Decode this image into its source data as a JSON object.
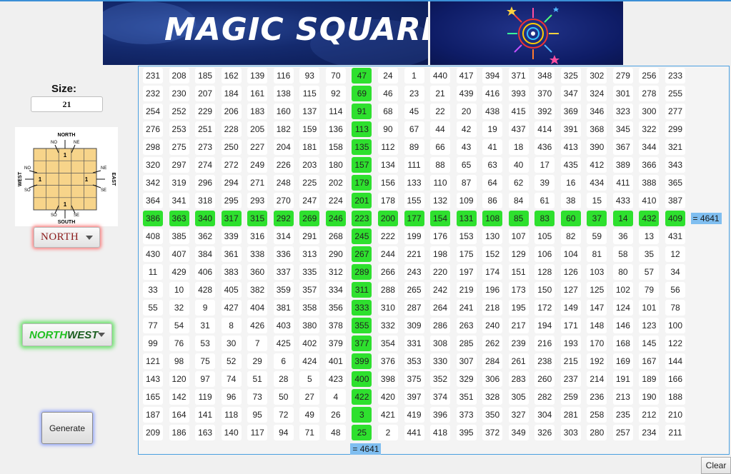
{
  "header": {
    "title": "MAGIC SQUARE"
  },
  "controls": {
    "size_label": "Size:",
    "size_value": "21",
    "compass": {
      "north": "NORTH",
      "south": "SOUTH",
      "east": "EAST",
      "west": "WEST",
      "nw": "NO",
      "ne": "NE",
      "sw": "SO",
      "se": "SE",
      "one": "1"
    },
    "start_direction": "NORTH",
    "move_direction": {
      "part1": "NORTH",
      "part2": "WEST"
    },
    "generate_label": "Generate"
  },
  "grid": {
    "size": 21,
    "highlight_row": 8,
    "highlight_col": 8,
    "rows": [
      [
        231,
        208,
        185,
        162,
        139,
        116,
        93,
        70,
        47,
        24,
        1,
        440,
        417,
        394,
        371,
        348,
        325,
        302,
        279,
        256,
        233
      ],
      [
        232,
        230,
        207,
        184,
        161,
        138,
        115,
        92,
        69,
        46,
        23,
        21,
        439,
        416,
        393,
        370,
        347,
        324,
        301,
        278,
        255
      ],
      [
        254,
        252,
        229,
        206,
        183,
        160,
        137,
        114,
        91,
        68,
        45,
        22,
        20,
        438,
        415,
        392,
        369,
        346,
        323,
        300,
        277
      ],
      [
        276,
        253,
        251,
        228,
        205,
        182,
        159,
        136,
        113,
        90,
        67,
        44,
        42,
        19,
        437,
        414,
        391,
        368,
        345,
        322,
        299
      ],
      [
        298,
        275,
        273,
        250,
        227,
        204,
        181,
        158,
        135,
        112,
        89,
        66,
        43,
        41,
        18,
        436,
        413,
        390,
        367,
        344,
        321
      ],
      [
        320,
        297,
        274,
        272,
        249,
        226,
        203,
        180,
        157,
        134,
        111,
        88,
        65,
        63,
        40,
        17,
        435,
        412,
        389,
        366,
        343
      ],
      [
        342,
        319,
        296,
        294,
        271,
        248,
        225,
        202,
        179,
        156,
        133,
        110,
        87,
        64,
        62,
        39,
        16,
        434,
        411,
        388,
        365
      ],
      [
        364,
        341,
        318,
        295,
        293,
        270,
        247,
        224,
        201,
        178,
        155,
        132,
        109,
        86,
        84,
        61,
        38,
        15,
        433,
        410,
        387
      ],
      [
        386,
        363,
        340,
        317,
        315,
        292,
        269,
        246,
        223,
        200,
        177,
        154,
        131,
        108,
        85,
        83,
        60,
        37,
        14,
        432,
        409
      ],
      [
        408,
        385,
        362,
        339,
        316,
        314,
        291,
        268,
        245,
        222,
        199,
        176,
        153,
        130,
        107,
        105,
        82,
        59,
        36,
        13,
        431
      ],
      [
        430,
        407,
        384,
        361,
        338,
        336,
        313,
        290,
        267,
        244,
        221,
        198,
        175,
        152,
        129,
        106,
        104,
        81,
        58,
        35,
        12
      ],
      [
        11,
        429,
        406,
        383,
        360,
        337,
        335,
        312,
        289,
        266,
        243,
        220,
        197,
        174,
        151,
        128,
        126,
        103,
        80,
        57,
        34
      ],
      [
        33,
        10,
        428,
        405,
        382,
        359,
        357,
        334,
        311,
        288,
        265,
        242,
        219,
        196,
        173,
        150,
        127,
        125,
        102,
        79,
        56
      ],
      [
        55,
        32,
        9,
        427,
        404,
        381,
        358,
        356,
        333,
        310,
        287,
        264,
        241,
        218,
        195,
        172,
        149,
        147,
        124,
        101,
        78
      ],
      [
        77,
        54,
        31,
        8,
        426,
        403,
        380,
        378,
        355,
        332,
        309,
        286,
        263,
        240,
        217,
        194,
        171,
        148,
        146,
        123,
        100
      ],
      [
        99,
        76,
        53,
        30,
        7,
        425,
        402,
        379,
        377,
        354,
        331,
        308,
        285,
        262,
        239,
        216,
        193,
        170,
        168,
        145,
        122
      ],
      [
        121,
        98,
        75,
        52,
        29,
        6,
        424,
        401,
        399,
        376,
        353,
        330,
        307,
        284,
        261,
        238,
        215,
        192,
        169,
        167,
        144
      ],
      [
        143,
        120,
        97,
        74,
        51,
        28,
        5,
        423,
        400,
        398,
        375,
        352,
        329,
        306,
        283,
        260,
        237,
        214,
        191,
        189,
        166
      ],
      [
        165,
        142,
        119,
        96,
        73,
        50,
        27,
        4,
        422,
        420,
        397,
        374,
        351,
        328,
        305,
        282,
        259,
        236,
        213,
        190,
        188
      ],
      [
        187,
        164,
        141,
        118,
        95,
        72,
        49,
        26,
        3,
        421,
        419,
        396,
        373,
        350,
        327,
        304,
        281,
        258,
        235,
        212,
        210
      ],
      [
        209,
        186,
        163,
        140,
        117,
        94,
        71,
        48,
        25,
        2,
        441,
        418,
        395,
        372,
        349,
        326,
        303,
        280,
        257,
        234,
        211
      ]
    ],
    "row_sum": "= 4641",
    "col_sum": "= 4641"
  },
  "clear_label": "Clear"
}
